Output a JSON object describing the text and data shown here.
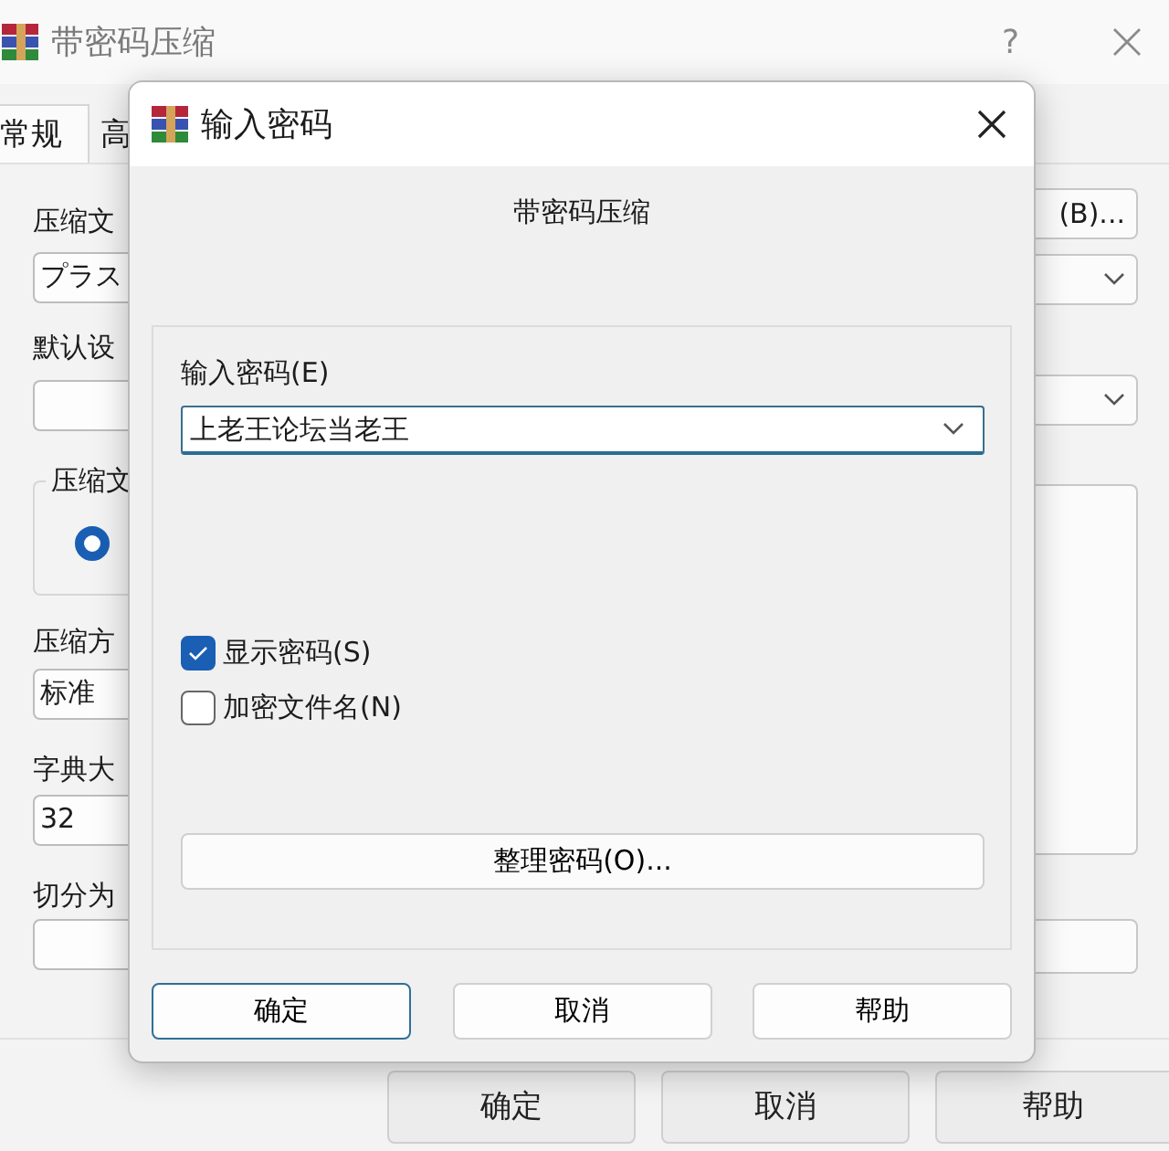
{
  "window": {
    "title": "带密码压缩",
    "help": "?"
  },
  "tabs": [
    {
      "label": "常规",
      "selected": true
    },
    {
      "label": "高",
      "selected": false
    }
  ],
  "background": {
    "archive_label": "压缩文",
    "archive_value": "プラス",
    "browse_button": "(B)...",
    "profile_label": "默认设",
    "format_group_label": "压缩文",
    "format_radio": {
      "selected": true
    },
    "method_label": "压缩方",
    "method_value": "标准",
    "dictionary_label": "字典大",
    "dictionary_value": "32",
    "split_label": "切分为"
  },
  "buttons": [
    "确定",
    "取消",
    "帮助"
  ],
  "dialog": {
    "title": "输入密码",
    "heading": "带密码压缩",
    "password_label": "输入密码(E)",
    "password_value": "上老王论坛当老王",
    "options": [
      {
        "label": "显示密码(S)",
        "checked": true
      },
      {
        "label": "加密文件名(N)",
        "checked": false
      }
    ],
    "organize_button": "整理密码(O)...",
    "buttons": [
      {
        "label": "确定",
        "default": true
      },
      {
        "label": "取消",
        "default": false
      },
      {
        "label": "帮助",
        "default": false
      }
    ]
  }
}
